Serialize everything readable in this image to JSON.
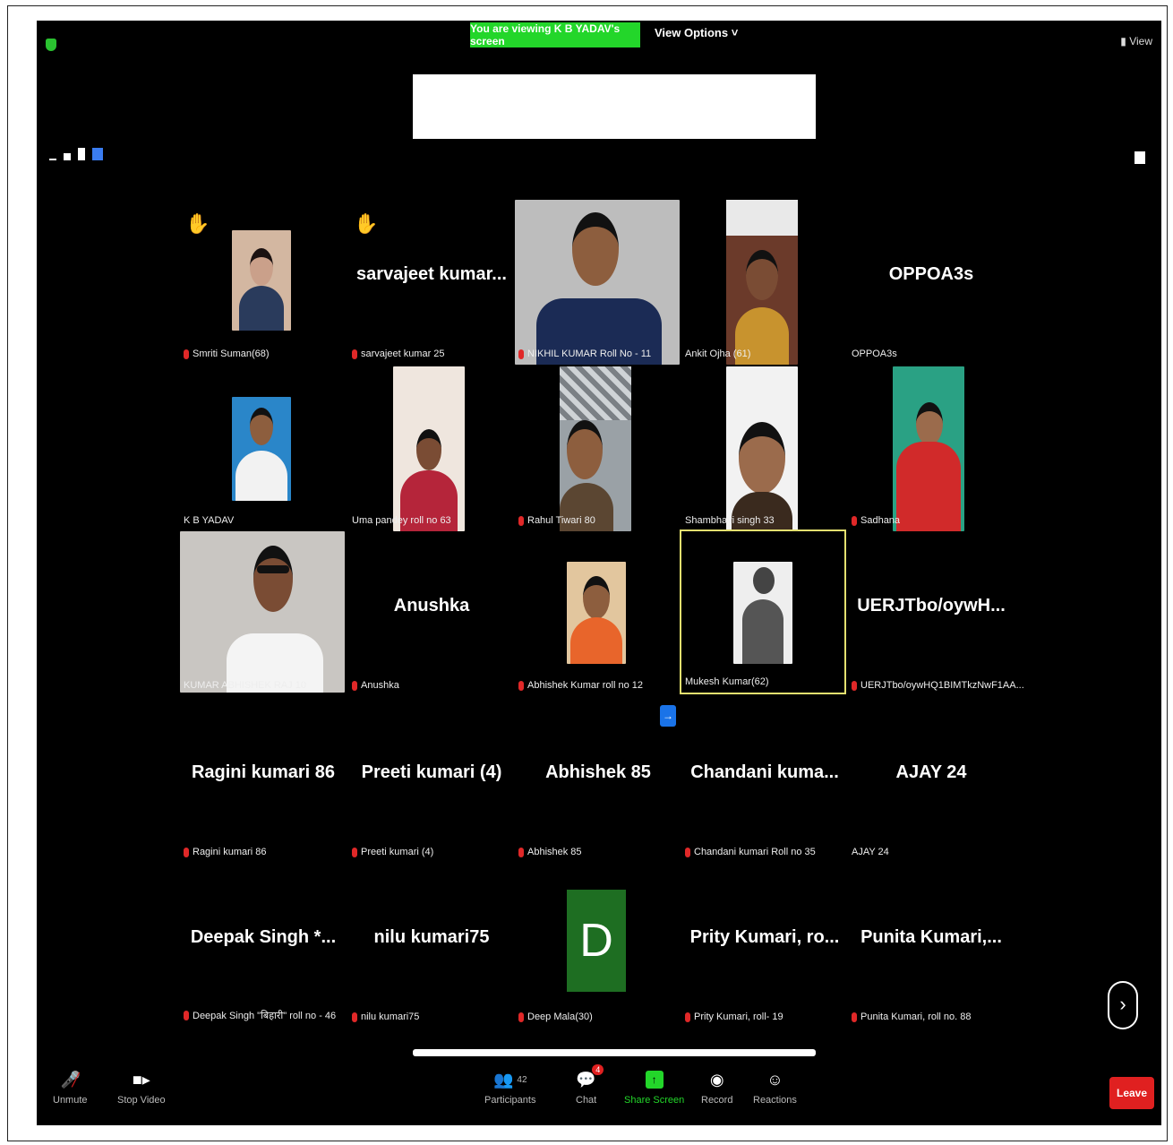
{
  "banner": {
    "viewing_text": "You are viewing K B YADAV's screen",
    "view_options": "View Options ˅",
    "view_label": "View"
  },
  "tiles": [
    {
      "big": "",
      "label": "Smriti Suman(68)",
      "muted": true,
      "hand": true
    },
    {
      "big": "sarvajeet kumar...",
      "label": "sarvajeet kumar 25",
      "muted": true,
      "hand": true
    },
    {
      "big": "",
      "label": "NIKHIL KUMAR Roll No - 11",
      "muted": true
    },
    {
      "big": "",
      "label": "Ankit Ojha (61)",
      "muted": false
    },
    {
      "big": "OPPOA3s",
      "label": "OPPOA3s",
      "muted": false
    },
    {
      "big": "",
      "label": "K B YADAV",
      "muted": false
    },
    {
      "big": "",
      "label": "Uma pandey roll no 63",
      "muted": false
    },
    {
      "big": "",
      "label": "Rahul Tiwari 80",
      "muted": true
    },
    {
      "big": "",
      "label": "Shambhavi singh 33",
      "muted": false
    },
    {
      "big": "",
      "label": "Sadhana",
      "muted": true
    },
    {
      "big": "",
      "label": "KUMAR ABHISHEK RAJ 10",
      "muted": false
    },
    {
      "big": "Anushka",
      "label": "Anushka",
      "muted": true
    },
    {
      "big": "",
      "label": "Abhishek Kumar roll no 12",
      "muted": true
    },
    {
      "big": "",
      "label": "Mukesh Kumar(62)",
      "muted": false
    },
    {
      "big": "UERJTbo/oywH...",
      "label": "UERJTbo/oywHQ1BIMTkzNwF1AA...",
      "muted": true
    },
    {
      "big": "Ragini kumari 86",
      "label": "Ragini kumari 86",
      "muted": true
    },
    {
      "big": "Preeti kumari (4)",
      "label": "Preeti kumari (4)",
      "muted": true
    },
    {
      "big": "Abhishek 85",
      "label": "Abhishek 85",
      "muted": true
    },
    {
      "big": "Chandani kuma...",
      "label": "Chandani kumari Roll no 35",
      "muted": true
    },
    {
      "big": "AJAY 24",
      "label": "AJAY 24",
      "muted": false
    },
    {
      "big": "Deepak Singh *...",
      "label": "Deepak Singh \"बिहारी\" roll no - 46",
      "muted": true
    },
    {
      "big": "nilu kumari75",
      "label": "nilu kumari75",
      "muted": true
    },
    {
      "big": "D",
      "label": "Deep Mala(30)",
      "muted": true
    },
    {
      "big": "Prity Kumari, ro...",
      "label": "Prity Kumari, roll- 19",
      "muted": true
    },
    {
      "big": "Punita Kumari,...",
      "label": "Punita Kumari, roll no. 88",
      "muted": true
    }
  ],
  "toolbar": {
    "unmute": "Unmute",
    "stop_video": "Stop Video",
    "participants": "Participants",
    "participant_count": "42",
    "chat": "Chat",
    "chat_badge": "4",
    "share_screen": "Share Screen",
    "record": "Record",
    "reactions": "Reactions",
    "leave": "Leave"
  },
  "colors": {
    "share_green": "#23d62a",
    "leave_red": "#e02020",
    "active_border": "#e4e06f",
    "avatar_green": "#1e6e22"
  }
}
